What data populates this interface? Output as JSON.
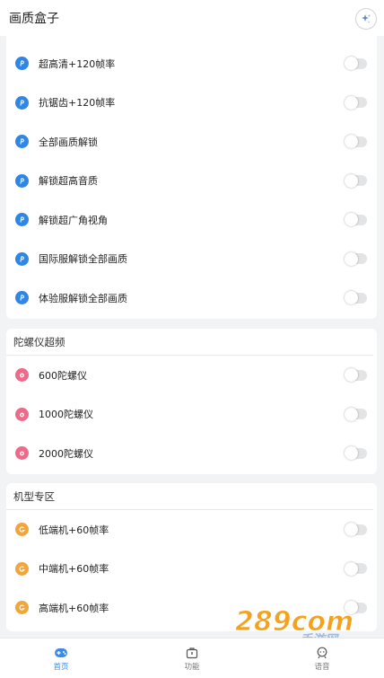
{
  "header": {
    "title": "画质盒子"
  },
  "sections": [
    {
      "title": "",
      "items": [
        {
          "label": "超高清+120帧率"
        },
        {
          "label": "抗锯齿+120帧率"
        },
        {
          "label": "全部画质解锁"
        },
        {
          "label": "解锁超高音质"
        },
        {
          "label": "解锁超广角视角"
        },
        {
          "label": "国际服解锁全部画质"
        },
        {
          "label": "体验服解锁全部画质"
        }
      ]
    },
    {
      "title": "陀螺仪超频",
      "items": [
        {
          "label": "600陀螺仪"
        },
        {
          "label": "1000陀螺仪"
        },
        {
          "label": "2000陀螺仪"
        }
      ]
    },
    {
      "title": "机型专区",
      "items": [
        {
          "label": "低端机+60帧率"
        },
        {
          "label": "中端机+60帧率"
        },
        {
          "label": "高端机+60帧率"
        }
      ]
    }
  ],
  "tabs": [
    {
      "label": "首页",
      "icon": "gamepad-icon",
      "active": true
    },
    {
      "label": "功能",
      "icon": "toolbox-icon",
      "active": false
    },
    {
      "label": "语音",
      "icon": "headset-icon",
      "active": false
    }
  ],
  "watermark": {
    "text": "289com",
    "subtext": "手游网"
  },
  "colors": {
    "accent": "#3c8be6",
    "section1_icon": "#2f86e5",
    "section2_icon": "#ef6a8a",
    "section3_icon": "#f2a53a",
    "toggle_off": "#e3e4e6"
  }
}
